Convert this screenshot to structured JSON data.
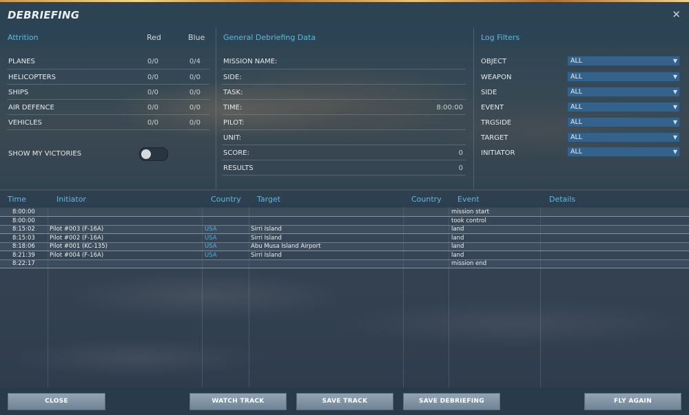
{
  "window": {
    "title": "DEBRIEFING",
    "close_glyph": "✕"
  },
  "attrition": {
    "heading": "Attrition",
    "col_red": "Red",
    "col_blue": "Blue",
    "rows": [
      {
        "label": "PLANES",
        "red": "0/0",
        "blue": "0/4"
      },
      {
        "label": "HELICOPTERS",
        "red": "0/0",
        "blue": "0/0"
      },
      {
        "label": "SHIPS",
        "red": "0/0",
        "blue": "0/0"
      },
      {
        "label": "AIR DEFENCE",
        "red": "0/0",
        "blue": "0/0"
      },
      {
        "label": "VEHICLES",
        "red": "0/0",
        "blue": "0/0"
      }
    ],
    "show_victories_label": "SHOW MY VICTORIES",
    "show_victories_on": false
  },
  "general": {
    "heading": "General Debriefing Data",
    "rows": [
      {
        "label": "MISSION NAME:",
        "value": ""
      },
      {
        "label": "SIDE:",
        "value": ""
      },
      {
        "label": "TASK:",
        "value": ""
      },
      {
        "label": "TIME:",
        "value": "8:00:00"
      },
      {
        "label": "PILOT:",
        "value": ""
      },
      {
        "label": "UNIT:",
        "value": ""
      },
      {
        "label": "SCORE:",
        "value": "0"
      },
      {
        "label": "RESULTS",
        "value": "0"
      }
    ]
  },
  "log_filters": {
    "heading": "Log Filters",
    "rows": [
      {
        "label": "OBJECT",
        "value": "ALL"
      },
      {
        "label": "WEAPON",
        "value": "ALL"
      },
      {
        "label": "SIDE",
        "value": "ALL"
      },
      {
        "label": "EVENT",
        "value": "ALL"
      },
      {
        "label": "TRGSIDE",
        "value": "ALL"
      },
      {
        "label": "TARGET",
        "value": "ALL"
      },
      {
        "label": "INITIATOR",
        "value": "ALL"
      }
    ]
  },
  "log_table": {
    "headers": {
      "time": "Time",
      "initiator": "Initiator",
      "country": "Country",
      "target": "Target",
      "target_country": "Country",
      "event": "Event",
      "details": "Details"
    },
    "rows": [
      {
        "time": "8:00:00",
        "initiator": "",
        "country": "",
        "target": "",
        "target_country": "",
        "event": "mission start",
        "details": ""
      },
      {
        "time": "8:00:00",
        "initiator": "",
        "country": "",
        "target": "",
        "target_country": "",
        "event": "took control",
        "details": ""
      },
      {
        "time": "8:15:02",
        "initiator": "Pilot #003 (F-16A)",
        "country": "USA",
        "target": "Sirri Island",
        "target_country": "",
        "event": "land",
        "details": ""
      },
      {
        "time": "8:15:03",
        "initiator": "Pilot #002 (F-16A)",
        "country": "USA",
        "target": "Sirri Island",
        "target_country": "",
        "event": "land",
        "details": ""
      },
      {
        "time": "8:18:06",
        "initiator": "Pilot #001 (KC-135)",
        "country": "USA",
        "target": "Abu Musa Island Airport",
        "target_country": "",
        "event": "land",
        "details": ""
      },
      {
        "time": "8:21:39",
        "initiator": "Pilot #004 (F-16A)",
        "country": "USA",
        "target": "Sirri Island",
        "target_country": "",
        "event": "land",
        "details": ""
      },
      {
        "time": "8:22:17",
        "initiator": "",
        "country": "",
        "target": "",
        "target_country": "",
        "event": "mission end",
        "details": ""
      }
    ]
  },
  "buttons": {
    "close": "CLOSE",
    "watch_track": "WATCH TRACK",
    "save_track": "SAVE TRACK",
    "save_debriefing": "SAVE DEBRIEFING",
    "fly_again": "FLY AGAIN"
  },
  "colors": {
    "accent_heading": "#63b8de",
    "country_link": "#58aee0",
    "dropdown_bg": "#34628a"
  }
}
